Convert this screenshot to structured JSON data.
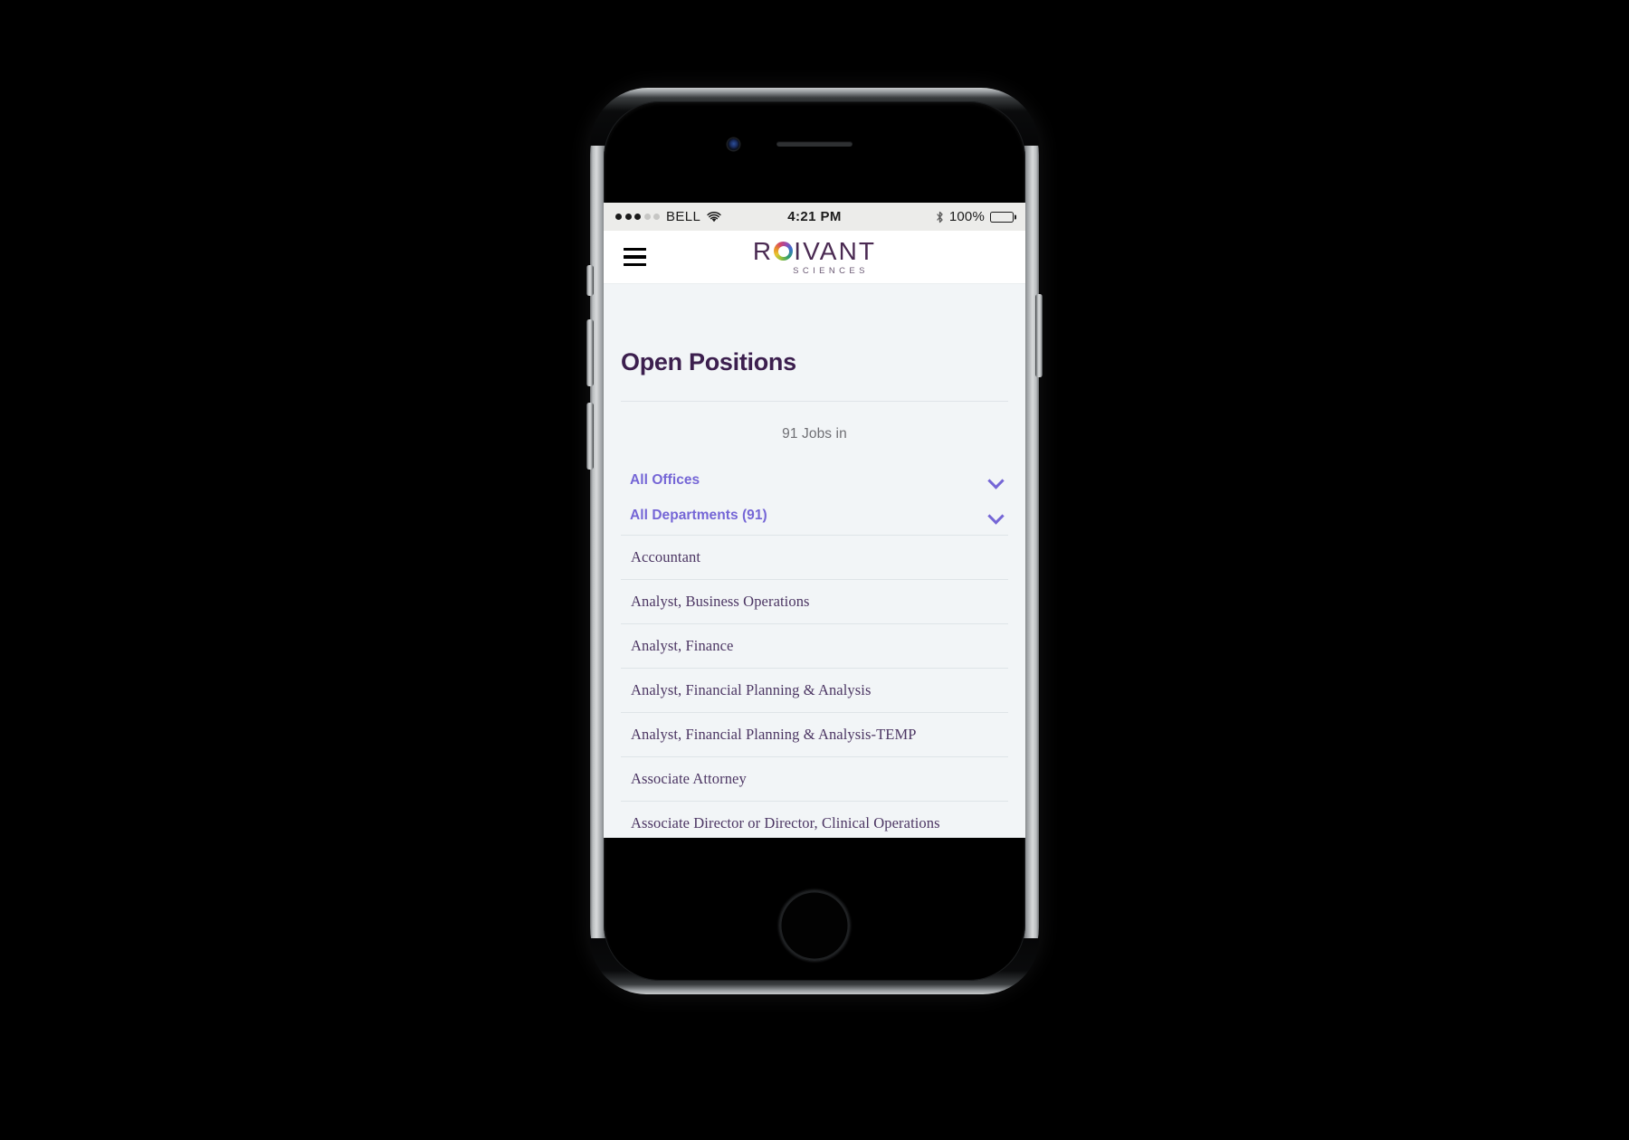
{
  "status_bar": {
    "signal_dots_filled": 3,
    "signal_dots_total": 5,
    "carrier": "BELL",
    "wifi_icon": "wifi-icon",
    "time": "4:21 PM",
    "bluetooth_icon": "bluetooth-icon",
    "battery_percent": "100%",
    "battery_icon": "battery-full-icon"
  },
  "app_header": {
    "menu_icon": "hamburger-menu-icon",
    "logo": {
      "part_before": "R",
      "ring_icon": "roivant-ring-logo-icon",
      "part_after": "IVANT",
      "subtitle": "SCIENCES"
    }
  },
  "main": {
    "page_title": "Open Positions",
    "jobs_count_text": "91 Jobs in",
    "filters": [
      {
        "label": "All Offices",
        "chevron": "chevron-down-icon"
      },
      {
        "label": "All Departments (91)",
        "chevron": "chevron-down-icon"
      }
    ],
    "jobs": [
      "Accountant",
      "Analyst, Business Operations",
      "Analyst, Finance",
      "Analyst, Financial Planning & Analysis",
      "Analyst, Financial Planning & Analysis-TEMP",
      "Associate Attorney",
      "Associate Director or Director, Clinical Operations"
    ]
  },
  "colors": {
    "page_background": "#f2f5f7",
    "title_purple": "#3c1f4e",
    "filter_purple": "#7566d6",
    "job_text_purple": "#4c3663",
    "logo_purple": "#4a2a52",
    "divider": "#dfe4e8",
    "status_bar_bg": "#ececea",
    "header_bg": "#ffffff",
    "device_black": "#000000"
  },
  "device": {
    "name": "iphone-mockup",
    "mute_switch": "mute-switch",
    "volume_up_button": "volume-up-button",
    "volume_down_button": "volume-down-button",
    "power_button": "power-button",
    "home_button": "home-button",
    "front_camera": "front-camera",
    "earpiece": "earpiece-speaker"
  }
}
